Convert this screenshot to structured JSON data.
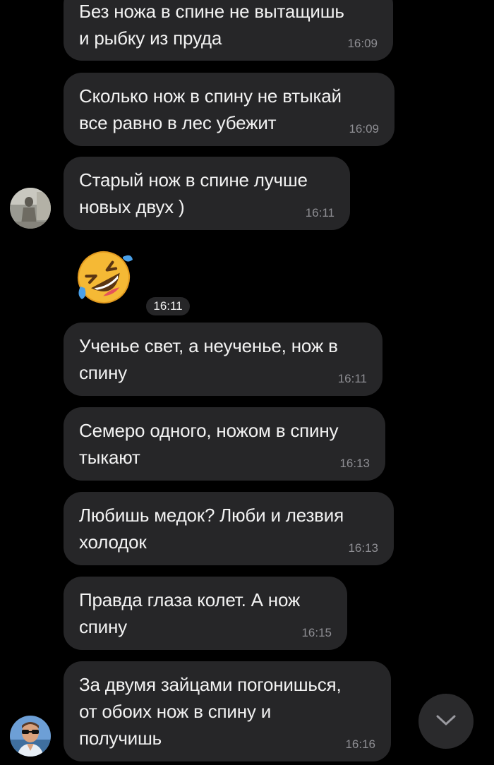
{
  "messages": [
    {
      "text": "Без ножа в спине не вытащишь\nи рыбку из пруда",
      "time": "16:09"
    },
    {
      "text": "Сколько нож в спину не втыкай\nвсе равно в лес убежит",
      "time": "16:09"
    },
    {
      "text": "Старый нож в спине лучше\nновых двух )",
      "time": "16:11"
    },
    {
      "emoji": "rolling-on-floor-laughing",
      "time": "16:11"
    },
    {
      "text": "Ученье свет, а неученье, нож в\nспину",
      "time": "16:11"
    },
    {
      "text": "Семеро одного, ножом в спину\nтыкают",
      "time": "16:13"
    },
    {
      "text": "Любишь медок? Люби и лезвия\nхолодок",
      "time": "16:13"
    },
    {
      "text": "Правда глаза колет. А нож\nспину",
      "time": "16:15"
    },
    {
      "text": "За двумя зайцами погонишься,\nот обоих нож в спину и\nполучишь",
      "time": "16:16"
    }
  ],
  "icons": {
    "scroll_down": "chevron-down-icon",
    "emoji": "rolling-laughing-emoji-icon"
  },
  "colors": {
    "background": "#000000",
    "bubble": "#262628",
    "text": "#f2f2f2",
    "time": "#8e8e93"
  }
}
